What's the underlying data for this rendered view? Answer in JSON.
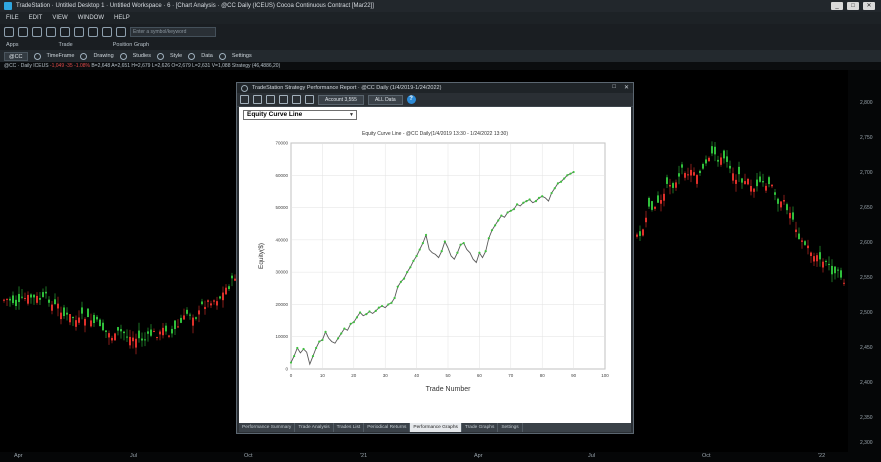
{
  "window": {
    "title": "TradeStation · Untitled Desktop 1 · Untitled Workspace · 6 · [Chart Analysis · @CC Daily (ICEUS) Cocoa Continuous Contract [Mar22]]",
    "buttons": [
      "_",
      "□",
      "✕"
    ]
  },
  "menu": [
    "FILE",
    "EDIT",
    "VIEW",
    "WINDOW",
    "HELP"
  ],
  "toolbar": {
    "search_placeholder": "Enter a symbol/keyword"
  },
  "app_labels": [
    "Apps",
    "Trade",
    "Position Graph"
  ],
  "chart_toolbar": {
    "symbol": "@CC",
    "items": [
      "TimeFrame",
      "Drawing",
      "Studies",
      "Style",
      "Data",
      "Settings"
    ]
  },
  "status_line": {
    "prefix": "@CC · Daily  ICEUS",
    "change": "-1,049  -35  -1.08%",
    "rest": "B=2,648  A=2,651  H=2,679  L=2,626  O=2,679  L=2,631  V=1,088  Strategy (46,4886,20)"
  },
  "price_axis": [
    "2,800",
    "2,750",
    "2,700",
    "2,650",
    "2,600",
    "2,550",
    "2,500",
    "2,450",
    "2,400",
    "2,350",
    "2,300"
  ],
  "time_axis": [
    "Apr",
    "Jul",
    "Oct",
    "'21",
    "Apr",
    "Jul",
    "Oct",
    "'22"
  ],
  "report": {
    "title": "TradeStation Strategy Performance Report · @CC Daily (1/4/2019-1/24/2022)",
    "account": "Account 3,555",
    "range": "ALL Data",
    "graph_type": "Equity Curve Line",
    "tabs": [
      "Performance Summary",
      "Trade Analysis",
      "Trades List",
      "Periodical Returns",
      "Performance Graphs",
      "Trade Graphs",
      "Settings"
    ],
    "active_tab": "Performance Graphs"
  },
  "chart_data": {
    "type": "line",
    "title": "Equity Curve Line - @CC Daily(1/4/2019 13:30 - 1/24/2022 13:30)",
    "xlabel": "Trade Number",
    "ylabel": "Equity($)",
    "xlim": [
      0,
      100
    ],
    "ylim": [
      0,
      70000
    ],
    "xticks": [
      0,
      10,
      20,
      30,
      40,
      50,
      60,
      70,
      80,
      90,
      100
    ],
    "yticks": [
      0,
      10000,
      20000,
      30000,
      40000,
      50000,
      60000,
      70000
    ],
    "grid": true,
    "series": [
      {
        "x": [
          0,
          1,
          2,
          3,
          4,
          5,
          6,
          7,
          8,
          9,
          10,
          11,
          12,
          13,
          14,
          15,
          16,
          17,
          18,
          19,
          20,
          21,
          22,
          23,
          24,
          25,
          26,
          27,
          28,
          29,
          30,
          31,
          32,
          33,
          34,
          35,
          36,
          37,
          38,
          39,
          40,
          41,
          42,
          43,
          44,
          45,
          46,
          47,
          48,
          49,
          50,
          51,
          52,
          53,
          54,
          55,
          56,
          57,
          58,
          59,
          60,
          61,
          62,
          63,
          64,
          65,
          66,
          67,
          68,
          69,
          70,
          71,
          72,
          73,
          74,
          75,
          76,
          77,
          78,
          79,
          80,
          81,
          82,
          83,
          84,
          85,
          86,
          87,
          88,
          89,
          90
        ],
        "values": [
          2000,
          4000,
          6500,
          5000,
          6200,
          5200,
          1500,
          4000,
          6500,
          8500,
          9000,
          11500,
          9500,
          8500,
          8000,
          9500,
          11000,
          12500,
          12000,
          14000,
          14500,
          16000,
          17500,
          16500,
          17000,
          17800,
          17200,
          18000,
          19000,
          19500,
          19000,
          20000,
          20500,
          22000,
          25500,
          27000,
          28000,
          30000,
          31500,
          33500,
          35000,
          37000,
          39000,
          41500,
          37000,
          36000,
          35500,
          34500,
          36500,
          39500,
          37500,
          35000,
          34000,
          36000,
          38500,
          39000,
          37000,
          36000,
          34000,
          33000,
          36000,
          34500,
          36500,
          40500,
          43000,
          44500,
          46000,
          47500,
          47000,
          48500,
          49000,
          49500,
          51000,
          50500,
          51500,
          52000,
          52500,
          51500,
          52000,
          53000,
          53500,
          53000,
          52000,
          54500,
          56000,
          57500,
          58000,
          59000,
          60000,
          60500,
          61000
        ]
      }
    ]
  }
}
